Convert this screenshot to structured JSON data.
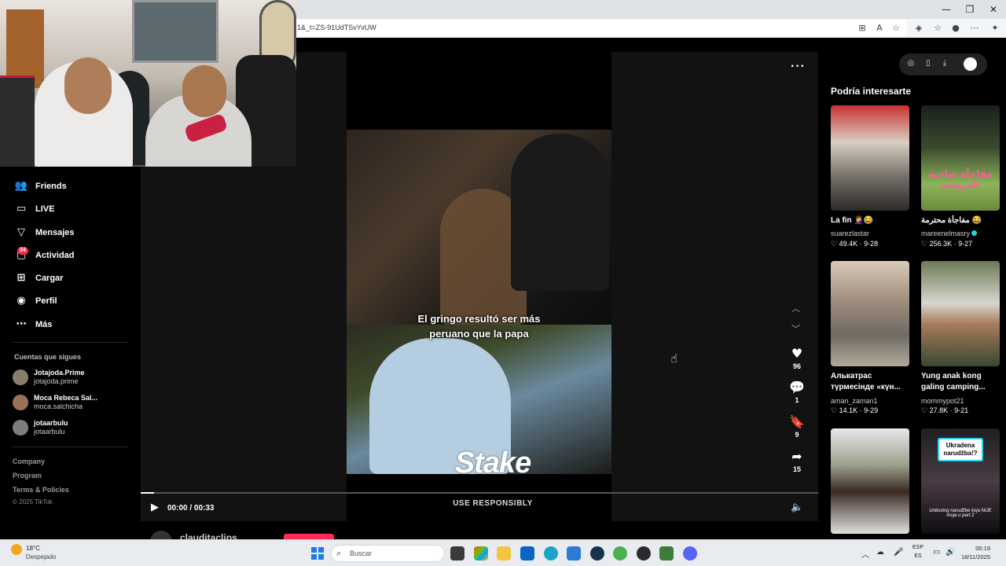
{
  "browser": {
    "url_fragment": "1&_t=ZS-91UdTSvYvUW",
    "window_controls": {
      "minimize": "—",
      "restore": "❐",
      "close": "✕"
    }
  },
  "sidebar": {
    "items": [
      {
        "label": "Friends",
        "icon": "friends-icon"
      },
      {
        "label": "LIVE",
        "icon": "live-icon"
      },
      {
        "label": "Mensajes",
        "icon": "messages-icon"
      },
      {
        "label": "Actividad",
        "icon": "activity-icon",
        "badge": "34"
      },
      {
        "label": "Cargar",
        "icon": "upload-icon"
      },
      {
        "label": "Perfil",
        "icon": "profile-icon"
      },
      {
        "label": "Más",
        "icon": "more-icon"
      }
    ],
    "following_title": "Cuentas que sigues",
    "following": [
      {
        "name": "Jotajoda.Prime",
        "handle": "jotajoda.prime"
      },
      {
        "name": "Moca Rebeca Sal...",
        "handle": "moca.salchicha"
      },
      {
        "name": "jotaarbulu",
        "handle": "jotaarbulu"
      }
    ],
    "footer": {
      "company": "Company",
      "program": "Program",
      "terms": "Terms & Policies",
      "copyright": "© 2025 TikTok"
    }
  },
  "video": {
    "caption_line1": "El gringo resultó ser más",
    "caption_line2": "peruano que la papa",
    "sponsor": "Stake",
    "sponsor_sub": "USE RESPONSIBLY",
    "likes": "96",
    "comments": "1",
    "saves": "9",
    "shares": "15",
    "time": "00:00 / 00:33",
    "progress": 0.02,
    "creator": "clauditaclips"
  },
  "recommendations": {
    "title": "Podría interesarte",
    "items": [
      {
        "title": "La fin 🤦‍♀️😂",
        "user": "suarezlastar",
        "likes": "49.4K",
        "date": "9-28",
        "verified": false
      },
      {
        "title": "مفاجأة محترمة 😂",
        "user": "mareenelmasry",
        "likes": "256.3K",
        "date": "9-27",
        "verified": true,
        "overlay": "مفاجأة صاحبة العروسة"
      },
      {
        "title": "Алькатрас түрмесінде «күн...",
        "user": "aman_zaman1",
        "likes": "14.1K",
        "date": "9-29",
        "verified": false
      },
      {
        "title": "Yung anak kong galing camping...",
        "user": "mommypot21",
        "likes": "27.8K",
        "date": "9-21",
        "verified": false
      },
      {
        "title": "",
        "user": "",
        "likes": "",
        "date": "",
        "verified": false
      },
      {
        "title": "",
        "user": "",
        "likes": "",
        "date": "",
        "verified": false,
        "overlay": "Ukradena narudžba!?",
        "overlay_sub": "Unboxing narudžbe koja NIJE moja u part 2"
      }
    ]
  },
  "taskbar": {
    "temperature": "18°C",
    "weather": "Despejado",
    "search_placeholder": "Buscar",
    "lang_top": "ESP",
    "lang_bottom": "ES",
    "time": "00:19",
    "date": "18/11/2025"
  },
  "colors": {
    "accent": "#fe2c55",
    "verified": "#20d5ec",
    "windows_blue": "#1c7ce3"
  }
}
